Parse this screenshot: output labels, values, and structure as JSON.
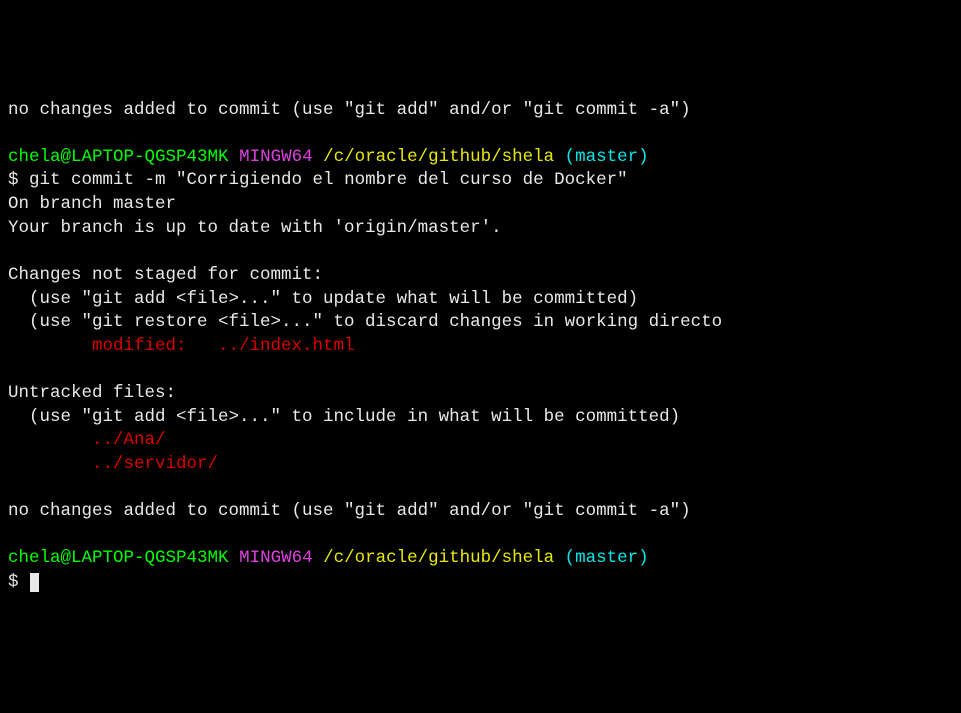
{
  "lines": {
    "no_changes_1": "no changes added to commit (use \"git add\" and/or \"git commit -a\")",
    "prompt_user_1": "chela@LAPTOP-QGSP43MK",
    "prompt_env_1": "MINGW64",
    "prompt_path_1": "/c/oracle/github/shela",
    "prompt_branch_1": "(master)",
    "dollar_1": "$ ",
    "cmd_1": "git commit -m \"Corrigiendo el nombre del curso de Docker\"",
    "on_branch": "On branch master",
    "up_to_date": "Your branch is up to date with 'origin/master'.",
    "changes_not_staged": "Changes not staged for commit:",
    "hint_add": "  (use \"git add <file>...\" to update what will be committed)",
    "hint_restore": "  (use \"git restore <file>...\" to discard changes in working directo",
    "modified": "        modified:   ../index.html",
    "untracked": "Untracked files:",
    "hint_include": "  (use \"git add <file>...\" to include in what will be committed)",
    "untracked_ana": "        ../Ana/",
    "untracked_servidor": "        ../servidor/",
    "no_changes_2": "no changes added to commit (use \"git add\" and/or \"git commit -a\")",
    "prompt_user_2": "chela@LAPTOP-QGSP43MK",
    "prompt_env_2": "MINGW64",
    "prompt_path_2": "/c/oracle/github/shela",
    "prompt_branch_2": "(master)",
    "dollar_2": "$ "
  }
}
